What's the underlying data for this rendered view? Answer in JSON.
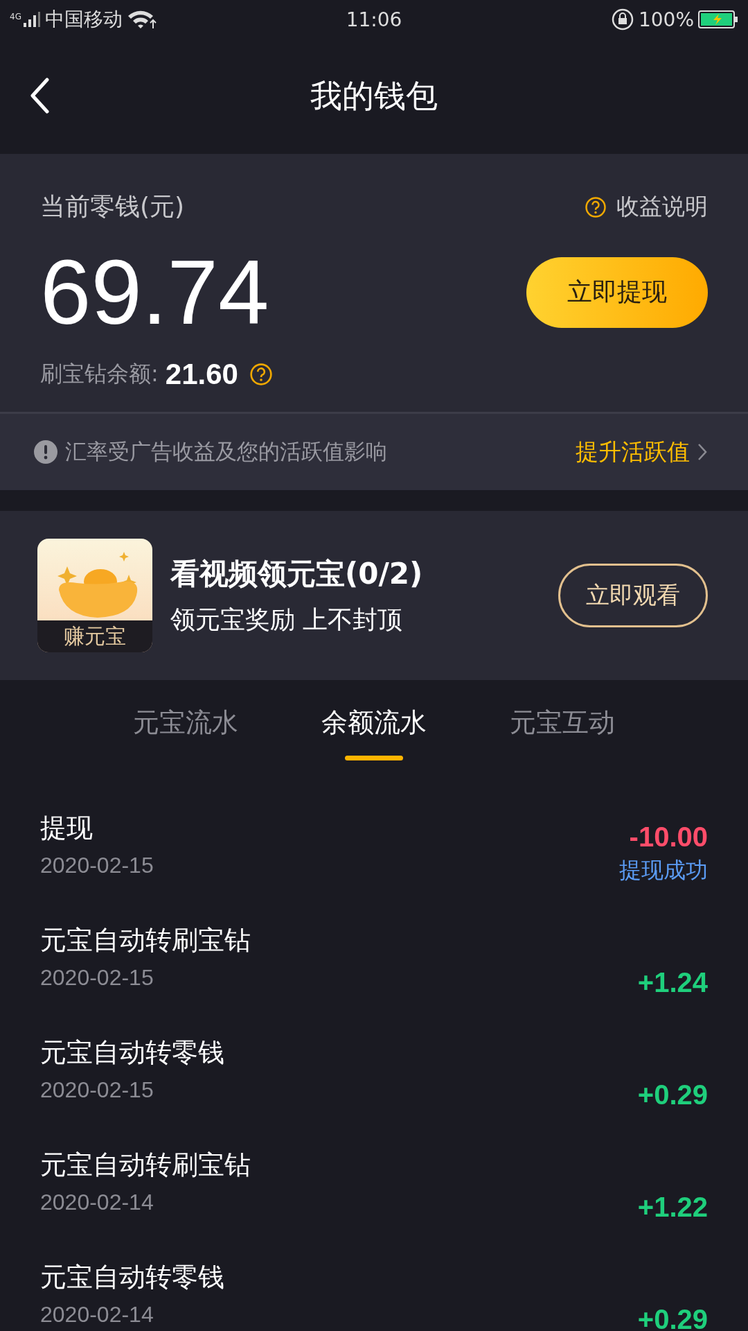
{
  "status_bar": {
    "network": "4G",
    "carrier": "中国移动",
    "time": "11:06",
    "battery_text": "100%"
  },
  "header": {
    "title": "我的钱包"
  },
  "balance": {
    "label": "当前零钱(元)",
    "help": "收益说明",
    "amount": "69.74",
    "withdraw_button": "立即提现",
    "diamond_label": "刷宝钻余额:",
    "diamond_amount": "21.60"
  },
  "notice": {
    "text": "汇率受广告收益及您的活跃值影响",
    "link": "提升活跃值"
  },
  "promo": {
    "badge": "赚元宝",
    "title": "看视频领元宝(0/2)",
    "subtitle": "领元宝奖励 上不封顶",
    "button": "立即观看"
  },
  "tabs": [
    {
      "label": "元宝流水",
      "selected": false
    },
    {
      "label": "余额流水",
      "selected": true
    },
    {
      "label": "元宝互动",
      "selected": false
    }
  ],
  "transactions": [
    {
      "title": "提现",
      "date": "2020-02-15",
      "amount": "-10.00",
      "kind": "expense",
      "status": "提现成功"
    },
    {
      "title": "元宝自动转刷宝钻",
      "date": "2020-02-15",
      "amount": "+1.24",
      "kind": "income"
    },
    {
      "title": "元宝自动转零钱",
      "date": "2020-02-15",
      "amount": "+0.29",
      "kind": "income"
    },
    {
      "title": "元宝自动转刷宝钻",
      "date": "2020-02-14",
      "amount": "+1.22",
      "kind": "income"
    },
    {
      "title": "元宝自动转零钱",
      "date": "2020-02-14",
      "amount": "+0.29",
      "kind": "income"
    }
  ]
}
